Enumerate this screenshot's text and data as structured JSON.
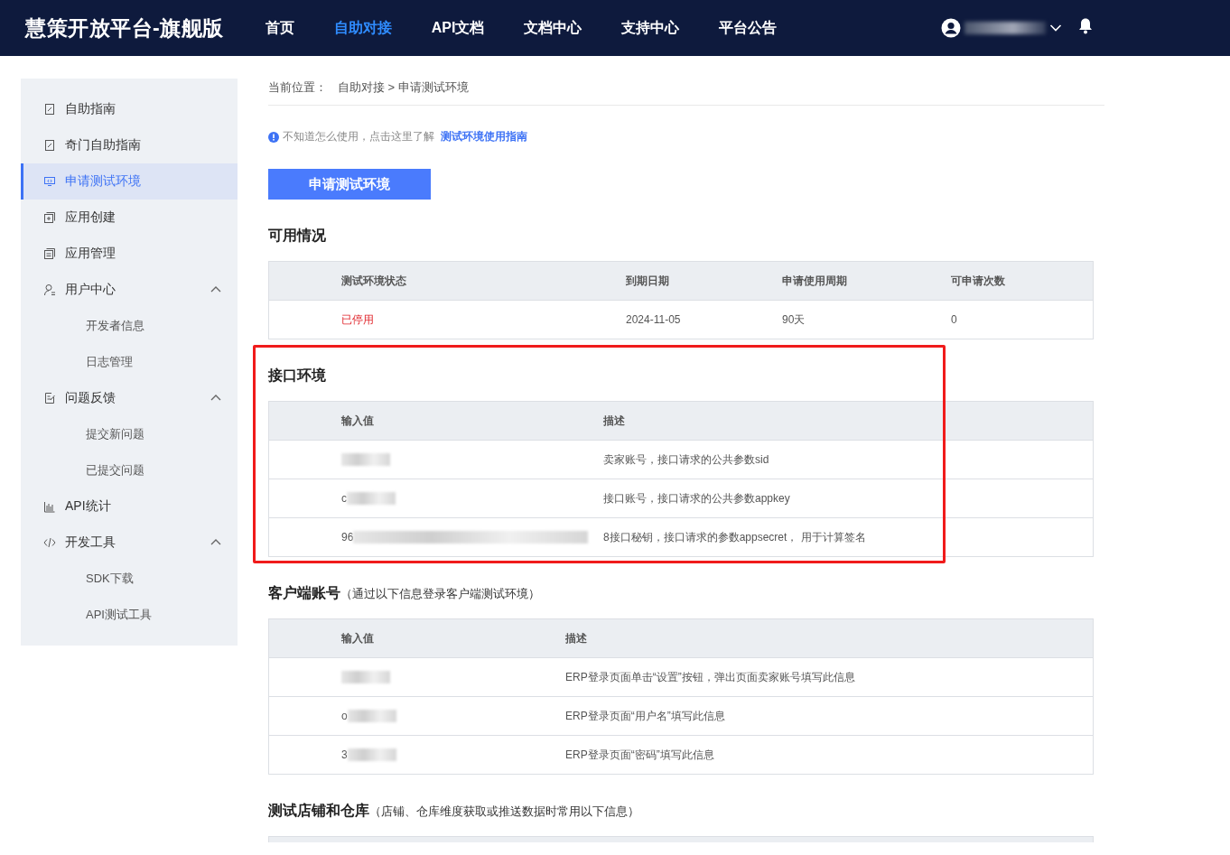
{
  "header": {
    "logo": "慧策开放平台-旗舰版",
    "nav": [
      {
        "label": "首页",
        "selected": false
      },
      {
        "label": "自助对接",
        "selected": true
      },
      {
        "label": "API文档",
        "selected": false
      },
      {
        "label": "文档中心",
        "selected": false
      },
      {
        "label": "支持中心",
        "selected": false
      },
      {
        "label": "平台公告",
        "selected": false
      }
    ],
    "user": {
      "redacted": true
    }
  },
  "sidebar": {
    "items": [
      {
        "label": "自助指南",
        "selected": false
      },
      {
        "label": "奇门自助指南",
        "selected": false
      },
      {
        "label": "申请测试环境",
        "selected": true
      },
      {
        "label": "应用创建",
        "selected": false
      },
      {
        "label": "应用管理",
        "selected": false
      },
      {
        "label": "用户中心",
        "selected": false,
        "expanded": true,
        "children": [
          {
            "label": "开发者信息",
            "selected": false
          },
          {
            "label": "日志管理",
            "selected": false
          }
        ]
      },
      {
        "label": "问题反馈",
        "selected": false,
        "expanded": true,
        "children": [
          {
            "label": "提交新问题",
            "selected": false
          },
          {
            "label": "已提交问题",
            "selected": false
          }
        ]
      },
      {
        "label": "API统计",
        "selected": false
      },
      {
        "label": "开发工具",
        "selected": false,
        "expanded": true,
        "children": [
          {
            "label": "SDK下载",
            "selected": false
          },
          {
            "label": "API测试工具",
            "selected": false
          }
        ]
      }
    ]
  },
  "breadcrumb": {
    "prefix": "当前位置：",
    "path": "自助对接 > 申请测试环境"
  },
  "notice": {
    "text": "不知道怎么使用，点击这里了解",
    "link": "测试环境使用指南"
  },
  "apply_button": "申请测试环境",
  "sections": [
    {
      "title": "可用情况",
      "highlighted": false,
      "columns": [
        "测试环境状态",
        "到期日期",
        "申请使用周期",
        "可申请次数"
      ],
      "rows": [
        {
          "cells": [
            {
              "text": "已停用",
              "kind": "status"
            },
            {
              "text": "2024-11-05",
              "kind": "text"
            },
            {
              "text": "90天",
              "kind": "text"
            },
            {
              "text": "0",
              "kind": "text"
            }
          ]
        }
      ]
    },
    {
      "title": "接口环境",
      "highlighted": true,
      "columns": [
        "输入值",
        "描述"
      ],
      "rows": [
        {
          "cells": [
            {
              "kind": "redacted"
            },
            {
              "text": "卖家账号，接口请求的公共参数sid",
              "kind": "text"
            }
          ]
        },
        {
          "cells": [
            {
              "text": "c",
              "kind": "redacted"
            },
            {
              "text": "接口账号，接口请求的公共参数appkey",
              "kind": "text"
            }
          ]
        },
        {
          "cells": [
            {
              "text": "96",
              "kind": "redacted_long"
            },
            {
              "text": "8接口秘钥，接口请求的参数appsecret， 用于计算签名",
              "kind": "text"
            }
          ]
        }
      ]
    },
    {
      "title": "客户端账号",
      "note": "（通过以下信息登录客户端测试环境）",
      "highlighted": false,
      "columns": [
        "输入值",
        "描述"
      ],
      "rows": [
        {
          "cells": [
            {
              "kind": "redacted"
            },
            {
              "text": "ERP登录页面单击“设置”按钮，弹出页面卖家账号填写此信息",
              "kind": "text"
            }
          ]
        },
        {
          "cells": [
            {
              "text": "o",
              "kind": "redacted"
            },
            {
              "text": "ERP登录页面“用户名”填写此信息",
              "kind": "text"
            }
          ]
        },
        {
          "cells": [
            {
              "text": "3",
              "kind": "redacted"
            },
            {
              "text": "ERP登录页面“密码”填写此信息",
              "kind": "text"
            }
          ]
        }
      ]
    },
    {
      "title": "测试店铺和仓库",
      "note": "（店铺、仓库维度获取或推送数据时常用以下信息）",
      "highlighted": false
    }
  ]
}
